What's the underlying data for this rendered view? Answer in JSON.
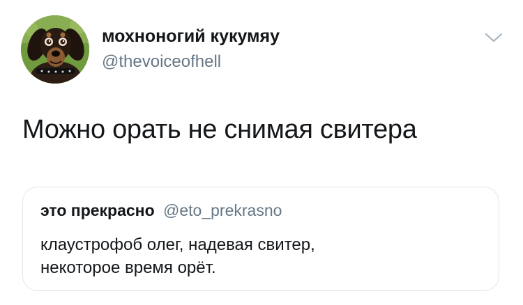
{
  "author": {
    "display_name": "мохноногий кукумяу",
    "handle": "@thevoiceofhell",
    "avatar_icon": "dachshund-avatar"
  },
  "menu": {
    "icon": "chevron-down-icon"
  },
  "tweet": {
    "text": "Можно орать не снимая свитера"
  },
  "quoted_tweet": {
    "display_name": "это прекрасно",
    "handle": "@eto_prekrasno",
    "text_lines": [
      "клаустрофоб олег, надевая свитер,",
      "некоторое время орёт."
    ]
  },
  "colors": {
    "primary_text": "#14171a",
    "secondary_text": "#657786",
    "border": "#dfe6ea"
  }
}
